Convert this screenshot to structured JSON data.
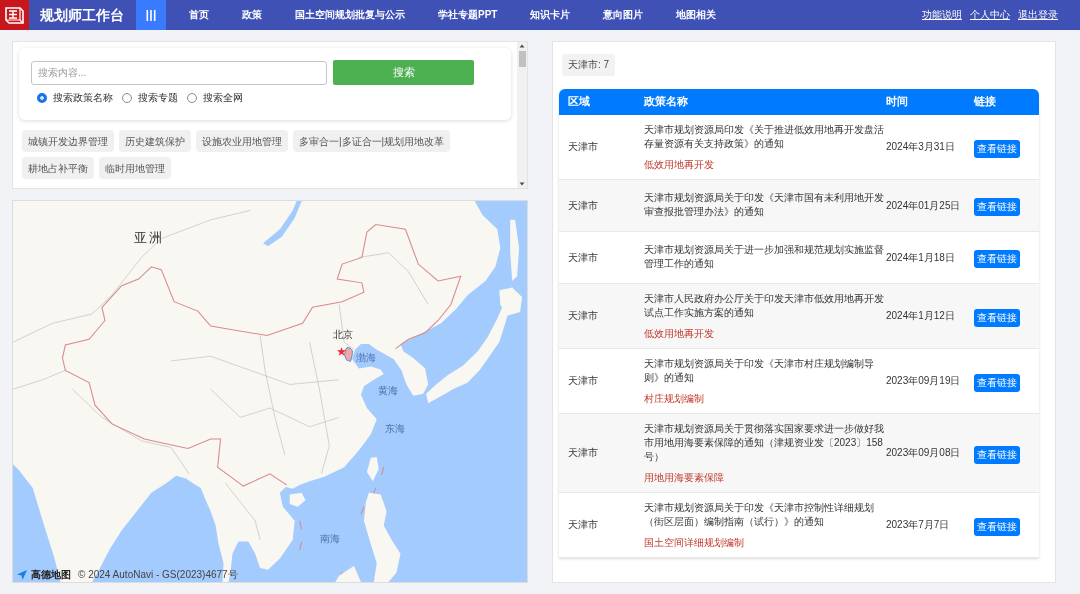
{
  "nav": {
    "title": "规划师工作台",
    "items": [
      "首页",
      "政策",
      "国土空间规划批复与公示",
      "学社专题PPT",
      "知识卡片",
      "意向图片",
      "地图相关"
    ],
    "links": [
      "功能说明",
      "个人中心",
      "退出登录"
    ]
  },
  "search": {
    "placeholder": "搜索内容...",
    "button": "搜索",
    "modes": [
      {
        "label": "搜索政策名称",
        "selected": true
      },
      {
        "label": "搜索专题",
        "selected": false
      },
      {
        "label": "搜索全网",
        "selected": false
      }
    ]
  },
  "tags": [
    "城镇开发边界管理",
    "历史建筑保护",
    "设施农业用地管理",
    "多审合一|多证合一|规划用地改革",
    "耕地占补平衡",
    "临时用地管理"
  ],
  "map": {
    "labels": [
      {
        "text": "亚洲",
        "kind": "continent"
      },
      {
        "text": "北京",
        "kind": "city"
      },
      {
        "text": "渤海",
        "kind": "sea"
      },
      {
        "text": "黄海",
        "kind": "sea"
      },
      {
        "text": "东海",
        "kind": "sea"
      },
      {
        "text": "南海",
        "kind": "sea"
      }
    ],
    "attribution": {
      "brand": "高德地图",
      "copyright": "© 2024 AutoNavi - GS(2023)4677号"
    }
  },
  "results": {
    "badge": "天津市: 7",
    "columns": [
      "区域",
      "政策名称",
      "时间",
      "链接"
    ],
    "rows": [
      {
        "region": "天津市",
        "title": "天津市规划资源局印发《关于推进低效用地再开发盘活存量资源有关支持政策》的通知",
        "tag": "低效用地再开发",
        "date": "2024年3月31日",
        "link": "查看链接"
      },
      {
        "region": "天津市",
        "title": "天津市规划资源局关于印发《天津市国有未利用地开发审查报批管理办法》的通知",
        "date": "2024年01月25日",
        "link": "查看链接"
      },
      {
        "region": "天津市",
        "title": "天津市规划资源局关于进一步加强和规范规划实施监督管理工作的通知",
        "date": "2024年1月18日",
        "link": "查看链接"
      },
      {
        "region": "天津市",
        "title": "天津市人民政府办公厅关于印发天津市低效用地再开发试点工作实施方案的通知",
        "tag": "低效用地再开发",
        "date": "2024年1月12日",
        "link": "查看链接"
      },
      {
        "region": "天津市",
        "title": "天津市规划资源局关于印发《天津市村庄规划编制导则》的通知",
        "tag": "村庄规划编制",
        "date": "2023年09月19日",
        "link": "查看链接"
      },
      {
        "region": "天津市",
        "title": "天津市规划资源局关于贯彻落实国家要求进一步做好我市用地用海要素保障的通知（津规资业发〔2023〕158号）",
        "tag": "用地用海要素保障",
        "date": "2023年09月08日",
        "link": "查看链接"
      },
      {
        "region": "天津市",
        "title": "天津市规划资源局关于印发《天津市控制性详细规划（街区层面）编制指南（试行）》的通知",
        "tag": "国土空间详细规划编制",
        "date": "2023年7月7日",
        "link": "查看链接"
      }
    ]
  }
}
